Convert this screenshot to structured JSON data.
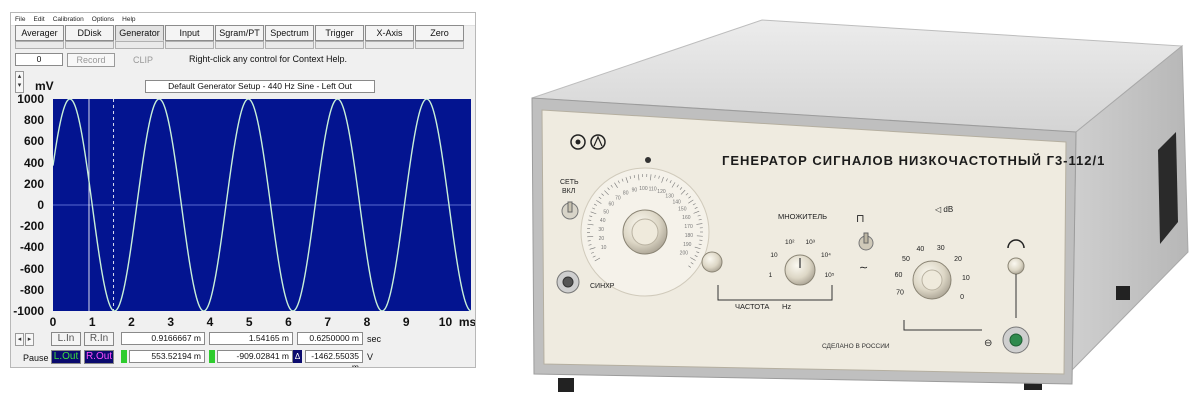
{
  "menu": [
    "File",
    "Edit",
    "Calibration",
    "Options",
    "Help"
  ],
  "tabs": [
    {
      "label": "Averager",
      "active": false
    },
    {
      "label": "DDisk",
      "active": false
    },
    {
      "label": "Generator",
      "active": true
    },
    {
      "label": "Input",
      "active": false
    },
    {
      "label": "Sgram/PT",
      "active": false
    },
    {
      "label": "Spectrum",
      "active": false
    },
    {
      "label": "Trigger",
      "active": false
    },
    {
      "label": "X-Axis",
      "active": false
    },
    {
      "label": "Zero",
      "active": false
    }
  ],
  "counter_value": "0",
  "record_label": "Record",
  "clip_label": "CLIP",
  "help_text": "Right-click any control for Context Help.",
  "setup_title": "Default Generator Setup - 440 Hz Sine - Left Out",
  "y_unit": "mV",
  "plot_colors": {
    "background": "#031490",
    "trace": "#c8f0d8",
    "cursor": "#ffffff"
  },
  "chart_data": {
    "type": "line",
    "title": "",
    "xlabel": "ms",
    "ylabel": "mV",
    "xlim": [
      0,
      10.65
    ],
    "ylim": [
      -1000,
      1000
    ],
    "x_ticks": [
      "0",
      "1",
      "2",
      "3",
      "4",
      "5",
      "6",
      "7",
      "8",
      "9",
      "10"
    ],
    "y_ticks": [
      "1000",
      "800",
      "600",
      "400",
      "200",
      "0",
      "-200",
      "-400",
      "-600",
      "-800",
      "-1000"
    ],
    "grid": false,
    "series": [
      {
        "waveform": "sine",
        "frequency_hz": 440,
        "amplitude_mv": 1000,
        "phase_rad": 0.38
      }
    ],
    "cursors_ms": [
      0.917,
      1.542
    ]
  },
  "readouts": {
    "lin": "L.In",
    "rin": "R.In",
    "cursor1": "0.9166667 m",
    "cursor2": "1.54165 m",
    "delta": "0.6250000 m",
    "time_unit": "sec",
    "pause": "Pause",
    "lout": "L.Out",
    "rout": "R.Out",
    "val1": "553.52194 m",
    "val2": "-909.02841 m",
    "val3": "-1462.55035 m",
    "volt_unit": "V"
  },
  "device": {
    "title": "ГЕНЕРАТОР СИГНАЛОВ НИЗКОЧАСТОТНЫЙ Г3-112/1",
    "power_label": "СЕТЬ",
    "power_label_2": "ВКЛ",
    "sync_label": "СИНХР",
    "multiplier_label": "МНОЖИТЕЛЬ",
    "multiplier_scale": [
      "1",
      "10",
      "10²",
      "10³",
      "10⁴",
      "10⁵"
    ],
    "freq_label": "ЧАСТОТА",
    "freq_unit": "Hz",
    "attenuator_label": "◁ dB",
    "attenuator_scale": [
      "60",
      "50",
      "40",
      "30",
      "20",
      "10",
      "0",
      "70"
    ],
    "dial_scale": [
      "10",
      "20",
      "30",
      "40",
      "50",
      "60",
      "70",
      "80",
      "90",
      "100",
      "110",
      "120",
      "130",
      "140",
      "150",
      "160",
      "170",
      "180",
      "190",
      "200"
    ],
    "made_in": "СДЕЛАНО В РОССИИ"
  }
}
